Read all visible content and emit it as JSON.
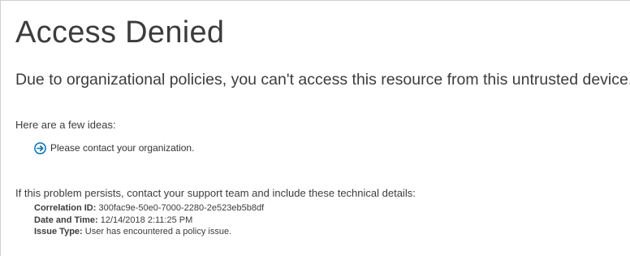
{
  "page": {
    "title": "Access Denied",
    "subtitle": "Due to organizational policies, you can't access this resource from this untrusted device."
  },
  "ideas": {
    "heading": "Here are a few ideas:",
    "items": [
      {
        "label": "Please contact your organization.",
        "icon": "arrow-circle-right-icon"
      }
    ]
  },
  "support": {
    "text": "If this problem persists, contact your support team and include these technical details:"
  },
  "details": [
    {
      "key": "Correlation ID:",
      "value": "300fac9e-50e0-7000-2280-2e523eb5b8df"
    },
    {
      "key": "Date and Time:",
      "value": "12/14/2018 2:11:25 PM"
    },
    {
      "key": "Issue Type:",
      "value": "User has encountered a policy issue."
    }
  ],
  "colors": {
    "accent": "#0072c6",
    "text": "#3c3c3c",
    "border": "#d0d0d0"
  }
}
